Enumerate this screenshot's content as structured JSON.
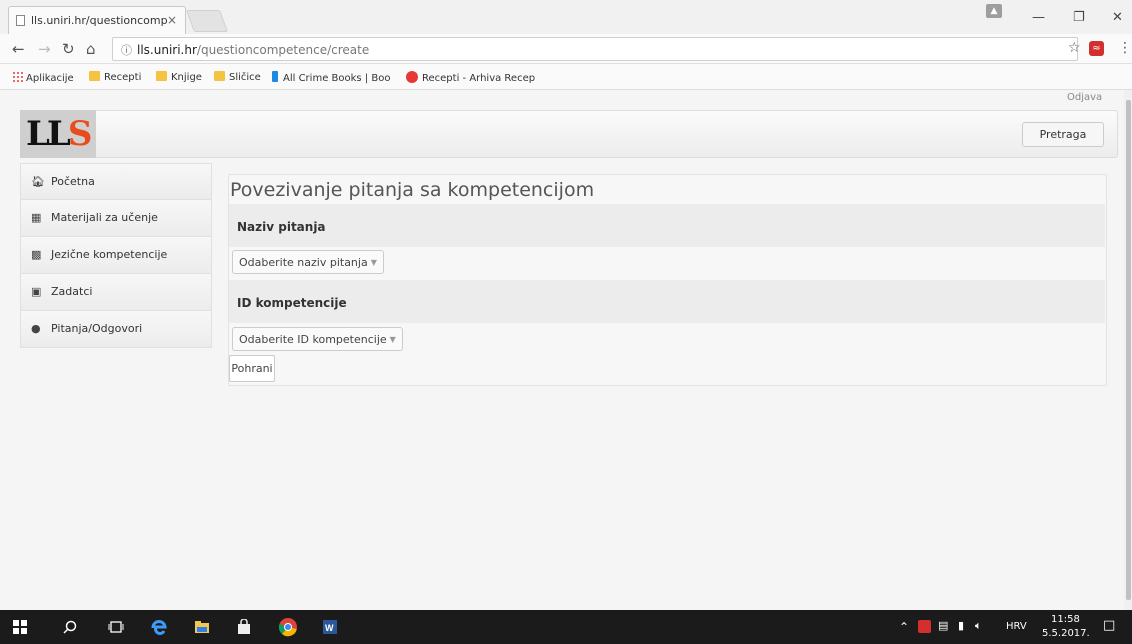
{
  "browser": {
    "tab_title": "lls.uniri.hr/questioncomp",
    "tab_close": "×",
    "url_host": "lls.uniri.hr",
    "url_path": "/questioncompetence/create",
    "bookmarks": [
      {
        "label": "Aplikacije",
        "icon": "apps-icon"
      },
      {
        "label": "Recepti",
        "icon": "folder-icon"
      },
      {
        "label": "Knjige",
        "icon": "folder-icon"
      },
      {
        "label": "Sličice",
        "icon": "folder-icon"
      },
      {
        "label": "All Crime Books | Boo",
        "icon": "book-icon"
      },
      {
        "label": "Recepti - Arhiva Recep",
        "icon": "recepti-site-icon"
      }
    ]
  },
  "header": {
    "logout_label": "Odjava",
    "search_label": "Pretraga",
    "logo_text_l": "LL",
    "logo_text_s": "S"
  },
  "sidebar": {
    "items": [
      {
        "label": "Početna",
        "icon": "home-icon"
      },
      {
        "label": "Materijali za učenje",
        "icon": "book-icon"
      },
      {
        "label": "Jezične kompetencije",
        "icon": "grid-icon"
      },
      {
        "label": "Zadatci",
        "icon": "clipboard-icon"
      },
      {
        "label": "Pitanja/Odgovori",
        "icon": "chat-icon"
      }
    ]
  },
  "main": {
    "title": "Povezivanje pitanja sa kompetencijom",
    "question_section_label": "Naziv pitanja",
    "question_dropdown_label": "Odaberite naziv pitanja",
    "competence_section_label": "ID kompetencije",
    "competence_dropdown_label": "Odaberite ID kompetencije",
    "save_label": "Pohrani"
  },
  "taskbar": {
    "language": "HRV",
    "time": "11:58",
    "date": "5.5.2017."
  },
  "colors": {
    "logo_accent": "#e94c1c",
    "taskbar_bg": "#1b1b1b"
  }
}
